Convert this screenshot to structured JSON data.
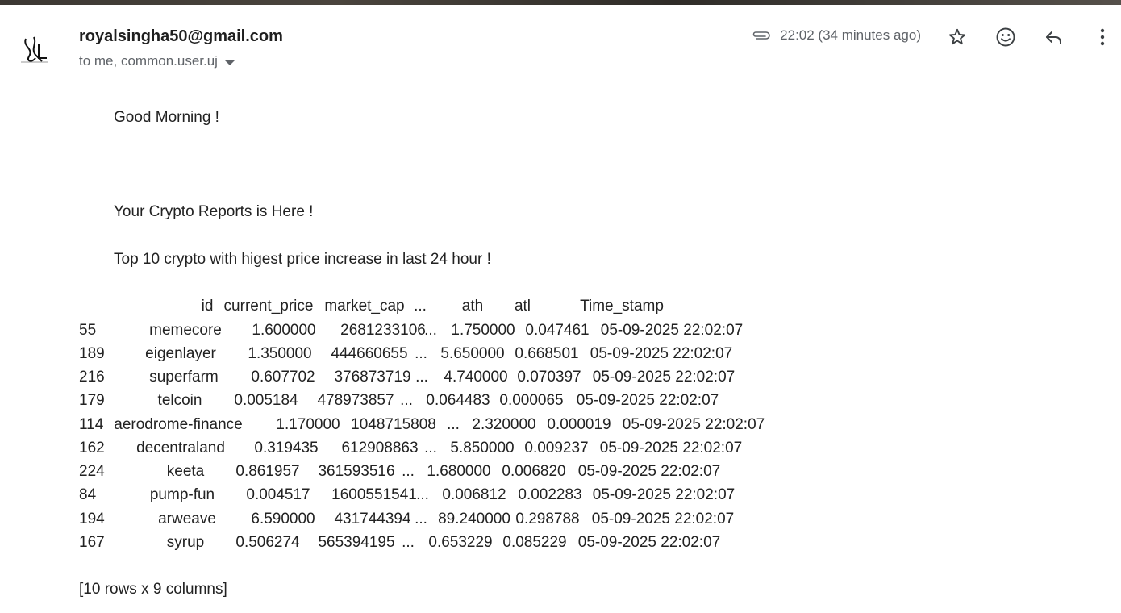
{
  "email": {
    "sender": "royalsingha50@gmail.com",
    "recipients": "to me, common.user.uj",
    "time": "22:02 (34 minutes ago)"
  },
  "icons": [
    "attachment-icon",
    "star-icon",
    "emoji-icon",
    "reply-icon",
    "more-vert-icon",
    "caret-down-icon",
    "avatar-logo"
  ],
  "body": {
    "greeting": "Good Morning !",
    "intro": "Your Crypto Reports is Here !",
    "subtitle": "Top 10 crypto with higest price increase in last 24 hour !",
    "footer": "[10 rows x 9 columns]"
  },
  "table": {
    "headers": [
      "id",
      "current_price",
      "market_cap",
      "...",
      "ath",
      "atl",
      "Time_stamp"
    ],
    "rows": [
      [
        "55",
        "memecore",
        "1.600000",
        "2681233106",
        "...",
        "1.750000",
        "0.047461",
        "05-09-2025 22:02:07"
      ],
      [
        "189",
        "eigenlayer",
        "1.350000",
        "444660655",
        "...",
        "5.650000",
        "0.668501",
        "05-09-2025 22:02:07"
      ],
      [
        "216",
        "superfarm",
        "0.607702",
        "376873719",
        "...",
        "4.740000",
        "0.070397",
        "05-09-2025 22:02:07"
      ],
      [
        "179",
        "telcoin",
        "0.005184",
        "478973857",
        "...",
        "0.064483",
        "0.000065",
        "05-09-2025 22:02:07"
      ],
      [
        "114",
        "aerodrome-finance",
        "1.170000",
        "1048715808",
        "...",
        "2.320000",
        "0.000019",
        "05-09-2025 22:02:07"
      ],
      [
        "162",
        "decentraland",
        "0.319435",
        "612908863",
        "...",
        "5.850000",
        "0.009237",
        "05-09-2025 22:02:07"
      ],
      [
        "224",
        "keeta",
        "0.861957",
        "361593516",
        "...",
        "1.680000",
        "0.006820",
        "05-09-2025 22:02:07"
      ],
      [
        "84",
        "pump-fun",
        "0.004517",
        "1600551541",
        "...",
        "0.006812",
        "0.002283",
        "05-09-2025 22:02:07"
      ],
      [
        "194",
        "arweave",
        "6.590000",
        "431744394",
        "...",
        "89.240000",
        "0.298788",
        "05-09-2025 22:02:07"
      ],
      [
        "167",
        "syrup",
        "0.506274",
        "565394195",
        "...",
        "0.653229",
        "0.085229",
        "05-09-2025 22:02:07"
      ]
    ]
  }
}
